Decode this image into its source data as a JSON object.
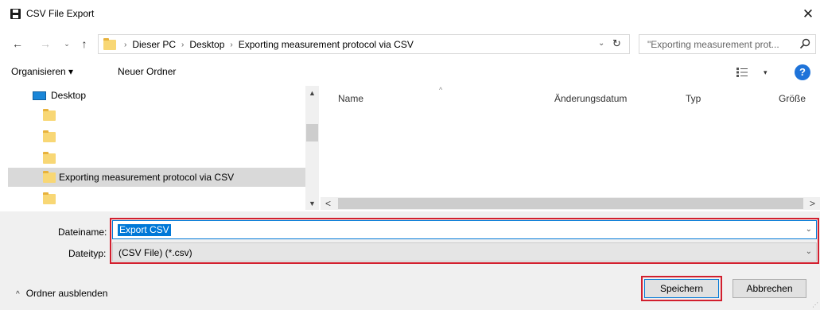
{
  "window": {
    "title": "CSV File Export",
    "close_label": "✕"
  },
  "nav": {
    "back_icon": "←",
    "forward_icon": "→",
    "recent_icon": "⌄",
    "up_icon": "↑",
    "breadcrumbs": [
      "Dieser PC",
      "Desktop",
      "Exporting measurement protocol via CSV"
    ],
    "separator": "›",
    "dropdown_icon": "⌄",
    "refresh_icon": "↻"
  },
  "search": {
    "placeholder": "\"Exporting measurement prot...",
    "icon": "search-icon"
  },
  "toolbar": {
    "organize_label": "Organisieren ▾",
    "new_folder_label": "Neuer Ordner",
    "view_arrow": "▾",
    "help_label": "?"
  },
  "tree": {
    "items": [
      {
        "label": "Desktop",
        "icon": "desktop-icon",
        "selected": false
      },
      {
        "label": "",
        "icon": "folder-icon",
        "selected": false
      },
      {
        "label": "",
        "icon": "folder-icon",
        "selected": false
      },
      {
        "label": "",
        "icon": "folder-icon",
        "selected": false
      },
      {
        "label": "Exporting measurement protocol via CSV",
        "icon": "folder-icon",
        "selected": true
      },
      {
        "label": "",
        "icon": "folder-icon",
        "selected": false
      }
    ]
  },
  "columns": {
    "name": "Name",
    "date": "Änderungsdatum",
    "type": "Typ",
    "size": "Größe",
    "sort_icon": "^"
  },
  "scroll": {
    "up": "▲",
    "down": "▼",
    "left": "<",
    "right": ">"
  },
  "form": {
    "filename_label": "Dateiname:",
    "filename_value": "Export CSV",
    "filetype_label": "Dateityp:",
    "filetype_value": "(CSV File) (*.csv)",
    "dropdown_arrow": "⌄"
  },
  "footer": {
    "hide_folders_chevron": "^",
    "hide_folders_label": "Ordner ausblenden",
    "save_label": "Speichern",
    "cancel_label": "Abbrechen"
  },
  "colors": {
    "highlight": "#d21f2e",
    "accent": "#0078d7",
    "help": "#1e73d9"
  }
}
